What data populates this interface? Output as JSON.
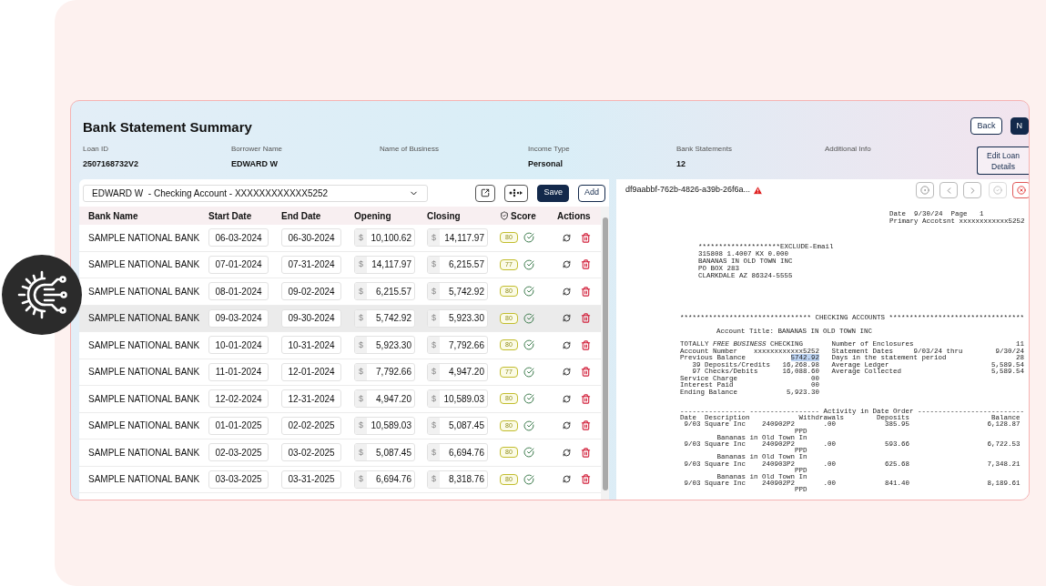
{
  "header": {
    "title": "Bank Statement Summary",
    "fields": [
      {
        "label": "Loan ID",
        "value": "2507168732V2"
      },
      {
        "label": "Borrower Name",
        "value": "EDWARD W"
      },
      {
        "label": "Name of Business"
      },
      {
        "label": "Income Type",
        "value": "Personal"
      },
      {
        "label": "Bank Statements",
        "value": "12"
      },
      {
        "label": "Additional Info"
      }
    ],
    "buttons": [
      {
        "label": "Back",
        "kind": "outline"
      },
      {
        "label": "N",
        "kind": "primary"
      }
    ],
    "edit_button": "Edit Loan Details"
  },
  "account_select": {
    "value": "EDWARD W  - Checking Account - XXXXXXXXXXXX5252"
  },
  "toolbar": {
    "buttons": [
      {
        "label": "Save",
        "kind": "primary"
      },
      {
        "label": "Add",
        "kind": "outline"
      }
    ]
  },
  "table": {
    "columns": [
      "Bank Name",
      "Start Date",
      "End Date",
      "Opening",
      "Closing",
      "Score",
      "Actions"
    ],
    "rows": [
      {
        "bank_name": "SAMPLE NATIONAL BANK",
        "start_date": "06-03-2024",
        "end_date": "06-30-2024",
        "opening": {
          "currency": "$",
          "amount": "10,100.62"
        },
        "closing": {
          "currency": "$",
          "amount": "14,117.97"
        },
        "score": "80",
        "selected": false
      },
      {
        "bank_name": "SAMPLE NATIONAL BANK",
        "start_date": "07-01-2024",
        "end_date": "07-31-2024",
        "opening": {
          "currency": "$",
          "amount": "14,117.97"
        },
        "closing": {
          "currency": "$",
          "amount": "6,215.57"
        },
        "score": "77",
        "selected": false
      },
      {
        "bank_name": "SAMPLE NATIONAL BANK",
        "start_date": "08-01-2024",
        "end_date": "09-02-2024",
        "opening": {
          "currency": "$",
          "amount": "6,215.57"
        },
        "closing": {
          "currency": "$",
          "amount": "5,742.92"
        },
        "score": "80",
        "selected": false
      },
      {
        "bank_name": "SAMPLE NATIONAL BANK",
        "start_date": "09-03-2024",
        "end_date": "09-30-2024",
        "opening": {
          "currency": "$",
          "amount": "5,742.92"
        },
        "closing": {
          "currency": "$",
          "amount": "5,923.30"
        },
        "score": "80",
        "selected": true
      },
      {
        "bank_name": "SAMPLE NATIONAL BANK",
        "start_date": "10-01-2024",
        "end_date": "10-31-2024",
        "opening": {
          "currency": "$",
          "amount": "5,923.30"
        },
        "closing": {
          "currency": "$",
          "amount": "7,792.66"
        },
        "score": "80",
        "selected": false
      },
      {
        "bank_name": "SAMPLE NATIONAL BANK",
        "start_date": "11-01-2024",
        "end_date": "12-01-2024",
        "opening": {
          "currency": "$",
          "amount": "7,792.66"
        },
        "closing": {
          "currency": "$",
          "amount": "4,947.20"
        },
        "score": "77",
        "selected": false
      },
      {
        "bank_name": "SAMPLE NATIONAL BANK",
        "start_date": "12-02-2024",
        "end_date": "12-31-2024",
        "opening": {
          "currency": "$",
          "amount": "4,947.20"
        },
        "closing": {
          "currency": "$",
          "amount": "10,589.03"
        },
        "score": "80",
        "selected": false
      },
      {
        "bank_name": "SAMPLE NATIONAL BANK",
        "start_date": "01-01-2025",
        "end_date": "02-02-2025",
        "opening": {
          "currency": "$",
          "amount": "10,589.03"
        },
        "closing": {
          "currency": "$",
          "amount": "5,087.45"
        },
        "score": "80",
        "selected": false
      },
      {
        "bank_name": "SAMPLE NATIONAL BANK",
        "start_date": "02-03-2025",
        "end_date": "03-02-2025",
        "opening": {
          "currency": "$",
          "amount": "5,087.45"
        },
        "closing": {
          "currency": "$",
          "amount": "6,694.76"
        },
        "score": "80",
        "selected": false
      },
      {
        "bank_name": "SAMPLE NATIONAL BANK",
        "start_date": "03-03-2025",
        "end_date": "03-31-2025",
        "opening": {
          "currency": "$",
          "amount": "6,694.76"
        },
        "closing": {
          "currency": "$",
          "amount": "8,318.76"
        },
        "score": "80",
        "selected": false
      }
    ]
  },
  "viewer": {
    "file_name": "df9aabbf-762b-4826-a39b-26f6a...",
    "warning": true,
    "document": {
      "blocks": [
        {
          "lines": [
            {
              "text": "Date  9/30/24  Page   1"
            },
            {
              "text": "Primary Accotsnt xxxxxxxxxxxx5252"
            }
          ]
        },
        {
          "lines": [
            {
              "text": "********************EXCLUDE-Email"
            },
            {
              "text": "315808 1.4007 KX 0.000"
            },
            {
              "text": "BANANAS IN OLD TOWN INC"
            },
            {
              "text": "PO BOX 283"
            },
            {
              "text": "CLARKDALE AZ 86324-5555"
            }
          ]
        },
        {
          "lines": [
            {
              "text": "******************************** CHECKING ACCOUNTS *********************************"
            }
          ]
        },
        {
          "lines": [
            {
              "text": "Account Title: BANANAS IN OLD TOWN INC"
            }
          ]
        },
        {
          "lines": [
            {
              "text": "TOTALLY ",
              "italic": "FREE BUSINESS",
              "after": " CHECKING       Number of Enclosures                         11"
            },
            {
              "text": "Account Number    xxxxxxxxxxxx5252   Statement Dates     9/03/24 thru        9/30/24"
            },
            {
              "text": "Previous Balance           ",
              "highlight": "5742.92",
              "after": "   Days in the statement period                 28"
            },
            {
              "text": "   39 Deposits/Credits   16,268.98   Average Ledger                         5,589.54"
            },
            {
              "text": "   97 Checks/Debits      16,088.60   Average Collected                      5,589.54"
            },
            {
              "text": "Service Charge                  00"
            },
            {
              "text": "Interest Paid                   00"
            },
            {
              "text": "Ending Balance            5,923.30"
            }
          ]
        },
        {
          "lines": [
            {
              "text": "---------------- ----------------- Activity in Date Order --------------------------"
            },
            {
              "text": "Date  Description            Withdrawals        Deposits                    Balance"
            },
            {
              "text": " 9/03 Square Inc    240902P2       .00            385.95                   6,128.87"
            },
            {
              "text": "                            PPD"
            },
            {
              "text": "         Bananas in Old Town In"
            },
            {
              "text": " 9/03 Square Inc    240902P2       .00            593.66                   6,722.53"
            },
            {
              "text": "                            PPD"
            },
            {
              "text": "         Bananas in Old Town In"
            },
            {
              "text": " 9/03 Square Inc    240903P2       .00            625.68                   7,348.21"
            },
            {
              "text": "                            PPD"
            },
            {
              "text": "         Bananas in Old Town In"
            },
            {
              "text": " 9/03 Square Inc    240902P2       .00            841.40                   8,189.61"
            },
            {
              "text": "                            PPD"
            }
          ]
        }
      ]
    }
  }
}
